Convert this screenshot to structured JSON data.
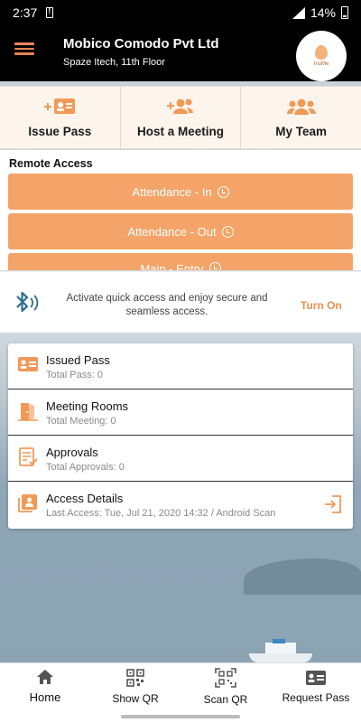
{
  "status_bar": {
    "time": "2:37",
    "battery": "14%"
  },
  "header": {
    "company": "Mobico Comodo Pvt Ltd",
    "location": "Spaze Itech, 11th Floor",
    "logo_text": "InuMe"
  },
  "quick_actions": [
    {
      "label": "Issue Pass",
      "icon": "id-card-add-icon"
    },
    {
      "label": "Host a Meeting",
      "icon": "add-user-icon"
    },
    {
      "label": "My Team",
      "icon": "team-icon"
    }
  ],
  "remote_access": {
    "title": "Remote Access",
    "buttons": [
      {
        "label": "Attendance - In"
      },
      {
        "label": "Attendance - Out"
      },
      {
        "label": "Main - Entry"
      }
    ]
  },
  "bluetooth": {
    "message": "Activate quick access and enjoy secure and seamless access.",
    "action": "Turn On"
  },
  "list": [
    {
      "title": "Issued Pass",
      "subtitle": "Total Pass: 0",
      "icon": "id-card-icon"
    },
    {
      "title": "Meeting Rooms",
      "subtitle": "Total Meeting: 0",
      "icon": "door-icon"
    },
    {
      "title": "Approvals",
      "subtitle": "Total Approvals: 0",
      "icon": "approval-doc-icon"
    },
    {
      "title": "Access Details",
      "subtitle": "Last Access: Tue, Jul 21, 2020 14:32 / Android Scan",
      "icon": "access-icon"
    }
  ],
  "bottom_nav": [
    {
      "label": "Home",
      "icon": "home-icon"
    },
    {
      "label": "Show QR",
      "icon": "qr-code-icon"
    },
    {
      "label": "Scan QR",
      "icon": "scan-qr-icon"
    },
    {
      "label": "Request Pass",
      "icon": "id-card-icon"
    }
  ],
  "colors": {
    "accent": "#f4a468",
    "header_bg": "#000000",
    "card_bg": "#fdf5ec"
  }
}
